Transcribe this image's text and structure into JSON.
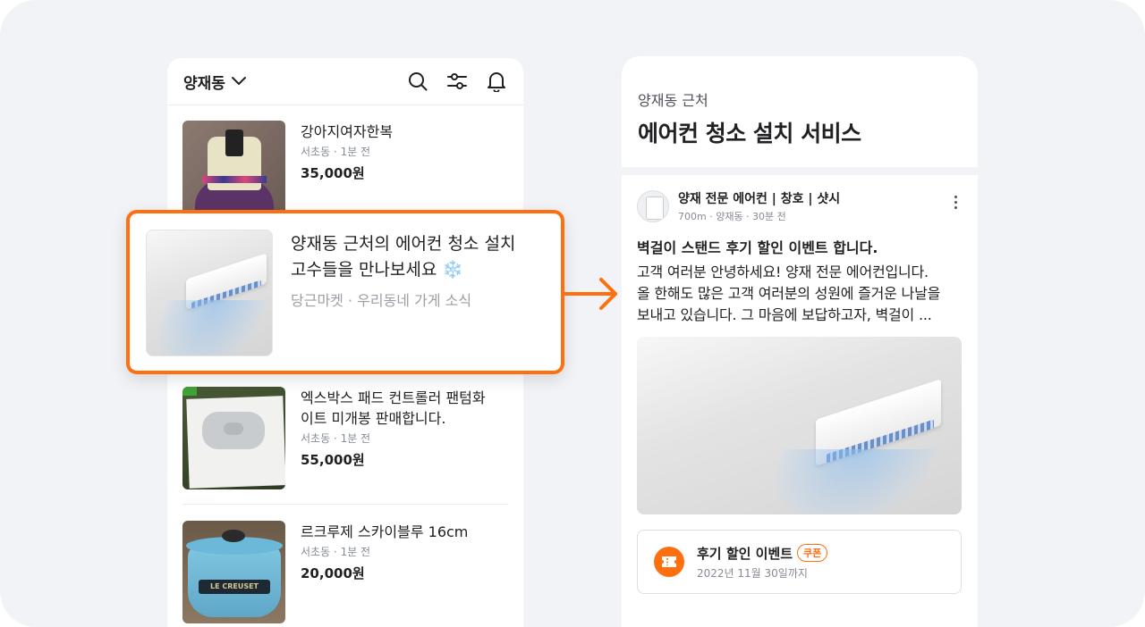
{
  "left_phone": {
    "location": "양재동",
    "items": [
      {
        "title": "강아지여자한복",
        "meta": "서초동 · 1분 전",
        "price": "35,000원"
      },
      {
        "title": "엑스박스 패드 컨트롤러 팬텀화이트 미개봉 판매합니다.",
        "title_line1": "엑스박스 패드 컨트롤러 팬텀화",
        "title_line2": "이트 미개봉 판매합니다.",
        "meta": "서초동 · 1분 전",
        "price": "55,000원"
      },
      {
        "title": "르크루제 스카이블루 16cm",
        "meta": "서초동 · 1분 전",
        "price": "20,000원",
        "pot_label": "LE CREUSET"
      }
    ]
  },
  "highlight": {
    "title_line1": "양재동 근처의 에어컨 청소 설치",
    "title_line2": "고수들을 만나보세요",
    "emoji": "❄️",
    "meta": "당근마켓 · 우리동네 가게 소식"
  },
  "right_phone": {
    "subtitle": "양재동 근처",
    "title": "에어컨 청소 설치 서비스",
    "author_name": "양재 전문 에어컨 | 창호 | 샷시",
    "author_meta": "700m · 양재동 · 30분 전",
    "post_title": "벽걸이 스탠드 후기 할인 이벤트 합니다.",
    "post_line1": "고객 여러분 안녕하세요! 양재 전문 에어컨입니다.",
    "post_line2": "올 한해도 많은 고객 여러분의 성원에 즐거운 나날을",
    "post_line3": "보내고 있습니다. 그 마음에 보답하고자, 벽걸이 ...",
    "coupon_title": "후기 할인 이벤트",
    "coupon_badge": "쿠폰",
    "coupon_date": "2022년 11월 30일까지"
  },
  "colors": {
    "accent": "#ff6f0f",
    "background": "#f2f3f6"
  },
  "icons": [
    "chevron-down-icon",
    "search-icon",
    "filter-icon",
    "bell-icon",
    "more-vertical-icon",
    "ticket-icon",
    "snowflake-icon",
    "arrow-right-icon"
  ]
}
